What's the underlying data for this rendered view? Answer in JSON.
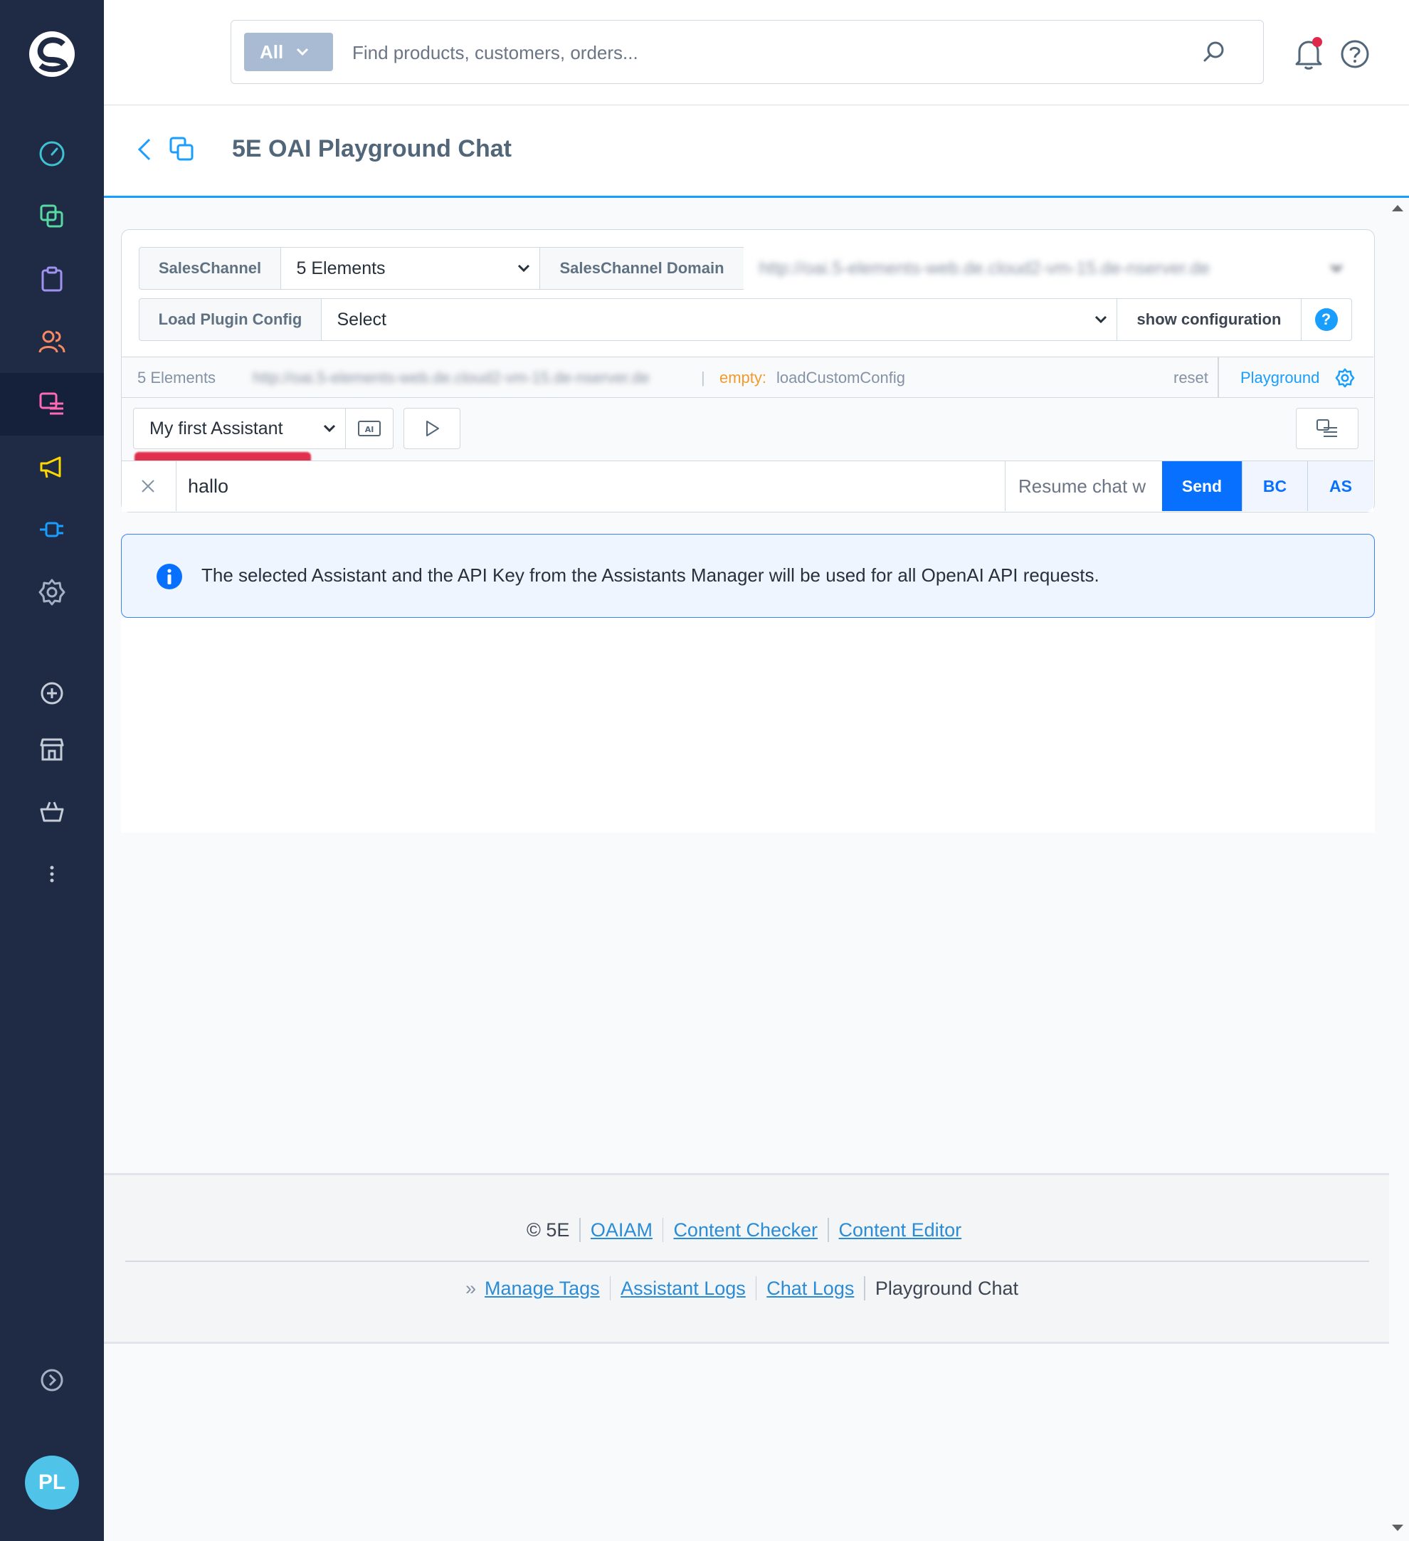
{
  "topbar": {
    "search_type": "All",
    "search_placeholder": "Find products, customers, orders..."
  },
  "page": {
    "title": "5E OAI Playground Chat"
  },
  "config": {
    "saleschannel_label": "SalesChannel",
    "saleschannel_value": "5 Elements",
    "domain_label": "SalesChannel Domain",
    "domain_value": "http://oai.5-elements-web.de.cloud2-vm-15.de-nserver.de",
    "plugin_config_label": "Load Plugin Config",
    "plugin_config_value": "Select",
    "show_config_label": "show configuration",
    "help_symbol": "?"
  },
  "status": {
    "saleschannel": "5 Elements",
    "domain": "http://oai.5-elements-web.de.cloud2-vm-15.de-nserver.de",
    "separator": "|",
    "empty_label": "empty:",
    "custom_config": "loadCustomConfig",
    "reset_label": "reset",
    "playground_label": "Playground"
  },
  "assistant": {
    "selected": "My first Assistant"
  },
  "chat": {
    "message_value": "hallo",
    "resume_placeholder": "Resume chat w",
    "send_label": "Send",
    "bc_label": "BC",
    "as_label": "AS"
  },
  "alert": {
    "text": "The selected Assistant and the API Key from the Assistants Manager will be used for all OpenAI API requests."
  },
  "footer": {
    "copyright": "© 5E",
    "links_top": [
      "OAIAM",
      "Content Checker",
      "Content Editor"
    ],
    "breadcrumb_marker": "»",
    "links_bottom": [
      "Manage Tags",
      "Assistant Logs",
      "Chat Logs"
    ],
    "current_page": "Playground Chat"
  },
  "user": {
    "initials": "PL"
  },
  "colors": {
    "sidebar_bg": "#1f2a44",
    "accent_blue": "#0870ff",
    "header_underline": "#189eff",
    "empty_orange": "#f29a2e",
    "avatar_bg": "#4fc3e8"
  }
}
